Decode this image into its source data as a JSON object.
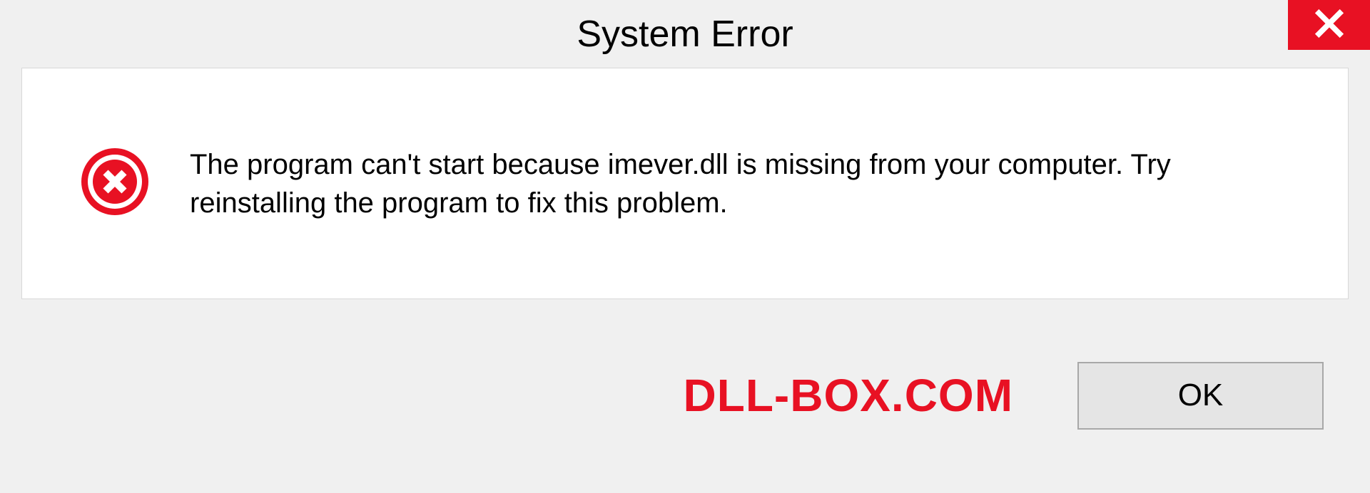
{
  "dialog": {
    "title": "System Error",
    "message": "The program can't start because imever.dll is missing from your computer. Try reinstalling the program to fix this problem.",
    "ok_label": "OK",
    "watermark": "DLL-BOX.COM"
  },
  "colors": {
    "accent_red": "#e81123",
    "bg_gray": "#f0f0f0",
    "panel_white": "#ffffff"
  }
}
